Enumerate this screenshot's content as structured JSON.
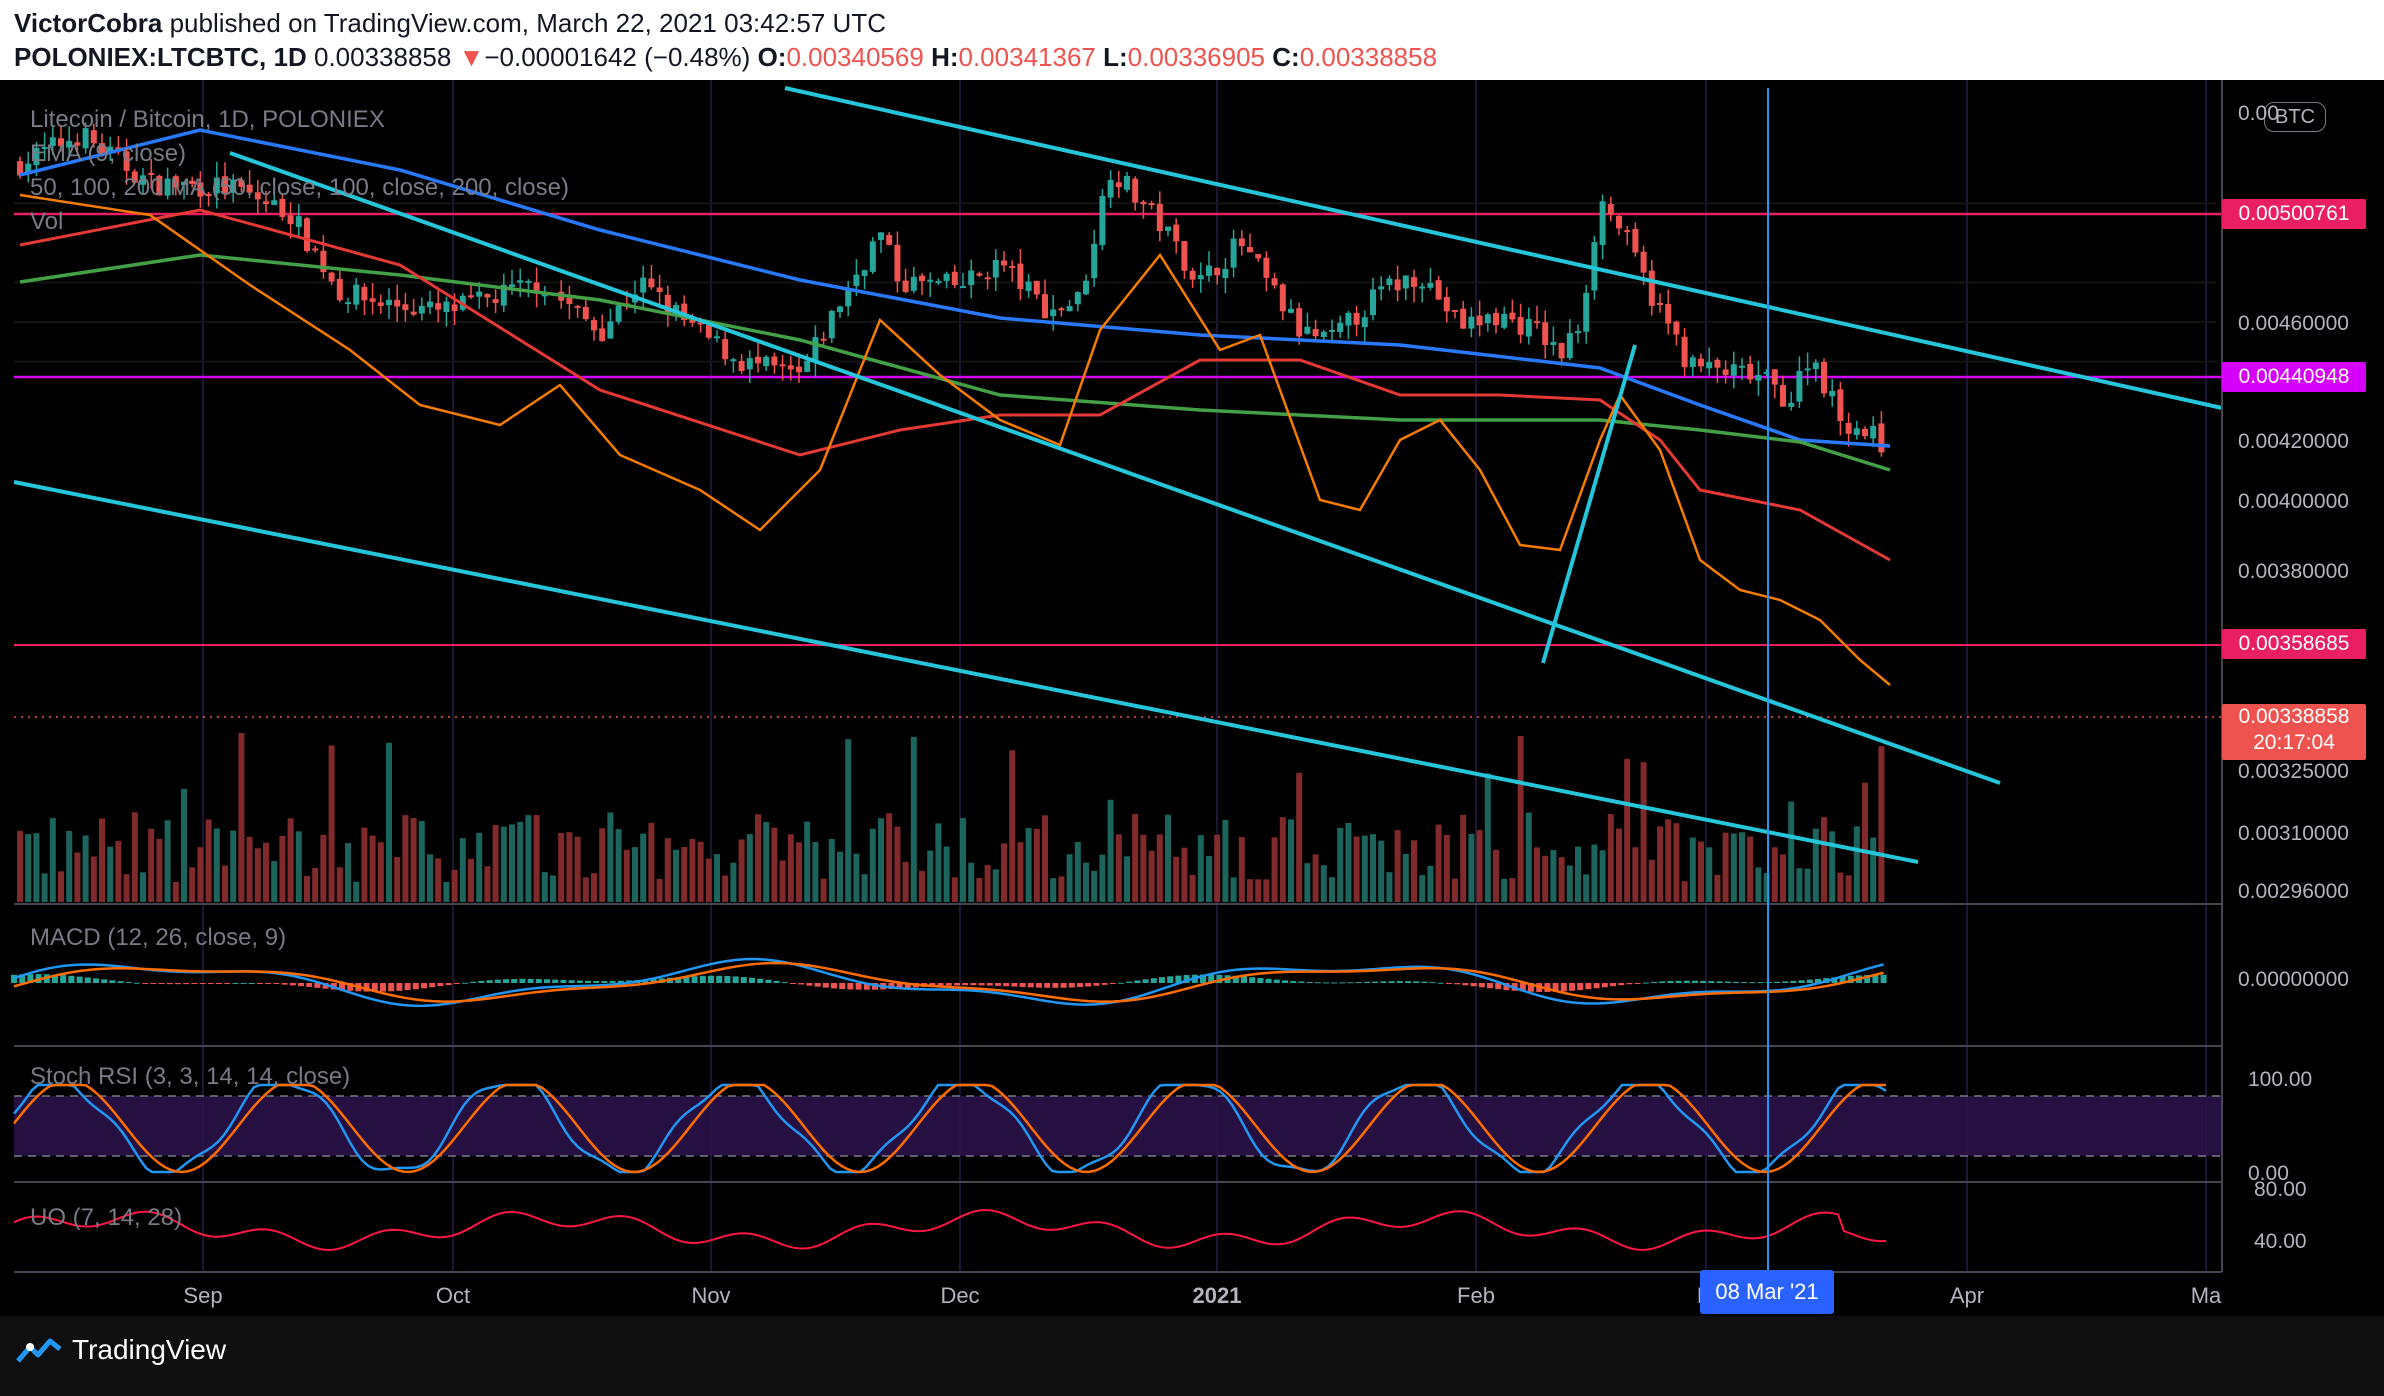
{
  "header": {
    "publisher": "VictorCobra",
    "published_text": "published on TradingView.com, March 22, 2021 03:42:57 UTC",
    "symbol": "POLONIEX:LTCBTC, 1D",
    "last_price": "0.00338858",
    "change_arrow": "▼",
    "change": "−0.00001642 (−0.48%)",
    "o_label": "O:",
    "o_value": "0.00340569",
    "h_label": "H:",
    "h_value": "0.00341367",
    "l_label": "L:",
    "l_value": "0.00336905",
    "c_label": "C:",
    "c_value": "0.00338858"
  },
  "legend": {
    "title": "Litecoin / Bitcoin, 1D, POLONIEX",
    "ema": "EMA (9, close)",
    "ma": "50, 100, 200 MA (50, close, 100, close, 200, close)",
    "vol": "Vol",
    "macd": "MACD (12, 26, close, 9)",
    "stoch": "Stoch RSI (3, 3, 14, 14, close)",
    "uo": "UO (7, 14, 28)"
  },
  "price_axis": {
    "currency_badge": "BTC",
    "ticks": [
      "0.00",
      "0.00460000",
      "0.00420000",
      "0.00400000",
      "0.00380000",
      "0.00325000",
      "0.00310000",
      "0.00296000"
    ],
    "macd_tick": "0.00000000",
    "stoch_ticks": [
      "100.00",
      "0.00"
    ],
    "uo_ticks": [
      "80.00",
      "40.00"
    ]
  },
  "price_labels": {
    "resistance_1": "0.00500761",
    "resistance_2": "0.00440948",
    "support": "0.00358685",
    "current": "0.00338858",
    "countdown": "20:17:04"
  },
  "time_axis": {
    "labels": [
      "Sep",
      "Oct",
      "Nov",
      "Dec",
      "2021",
      "Feb",
      "M",
      "Apr",
      "Ma"
    ],
    "crosshair_date": "08 Mar '21"
  },
  "footer": {
    "brand": "TradingView"
  },
  "colors": {
    "channel": "#26c6da",
    "ema": "#f57c00",
    "ma50": "#e53935",
    "ma100": "#43a047",
    "ma200": "#2979ff",
    "up": "#26a69a",
    "down": "#ef5350",
    "hline_red": "#e91e63",
    "hline_magenta": "#d500f9",
    "crosshair": "#2196f3"
  },
  "chart_data": {
    "type": "line",
    "symbol": "LTCBTC",
    "series": [
      {
        "name": "EMA (9, close)",
        "values": [
          0.00475,
          0.00455,
          0.00425,
          0.00412,
          0.00395,
          0.00378,
          0.0044,
          0.004,
          0.0039,
          0.0041,
          0.004,
          0.0044,
          0.0038,
          0.00378,
          0.00348
        ]
      },
      {
        "name": "50 MA",
        "values": [
          0.0048,
          0.0049,
          0.0045,
          0.0043,
          0.00412,
          0.0041,
          0.0042,
          0.0043,
          0.00438,
          0.00436,
          0.00428,
          0.0041,
          0.00392,
          0.00383
        ]
      },
      {
        "name": "100 MA",
        "values": [
          0.00465,
          0.0046,
          0.0045,
          0.0044,
          0.00432,
          0.00425,
          0.00425,
          0.00422,
          0.00425,
          0.00425,
          0.0042,
          0.0041
        ]
      },
      {
        "name": "200 MA",
        "values": [
          0.00535,
          0.0051,
          0.0049,
          0.0048,
          0.0047,
          0.0046,
          0.00455,
          0.00455,
          0.00448,
          0.0044,
          0.0043,
          0.00419
        ]
      }
    ],
    "levels": [
      0.00500761,
      0.00440948,
      0.00358685
    ],
    "x_labels": [
      "Sep",
      "Oct",
      "Nov",
      "Dec",
      "2021",
      "Feb",
      "M",
      "Apr",
      "Ma"
    ]
  }
}
